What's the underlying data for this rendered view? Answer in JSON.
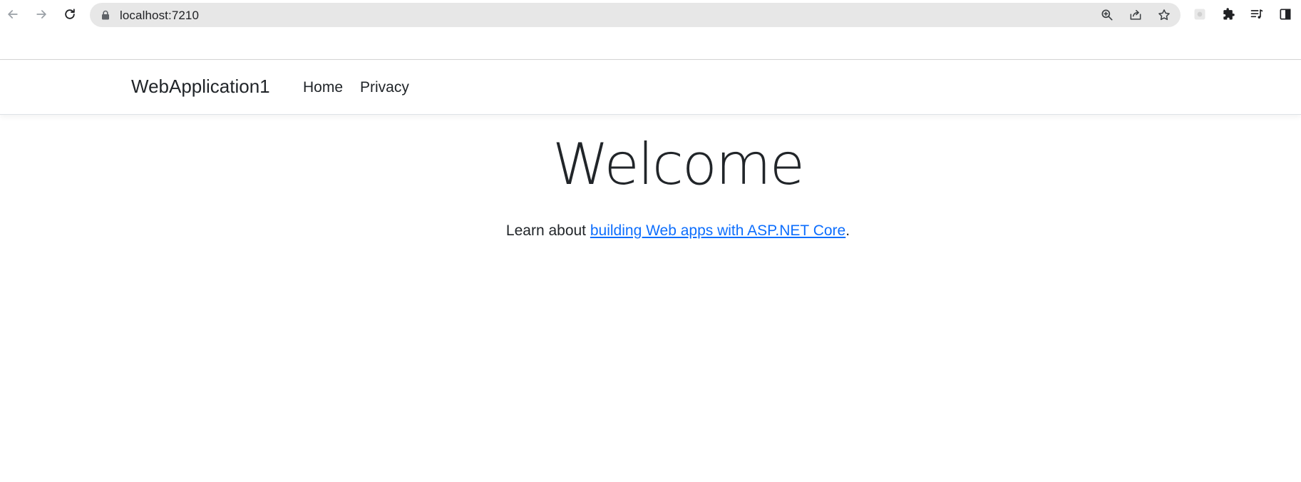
{
  "browser": {
    "url": "localhost:7210",
    "icons": {
      "back": "arrow-left-icon",
      "forward": "arrow-right-icon",
      "reload": "reload-icon",
      "lock": "lock-icon",
      "zoom": "zoom-icon",
      "share": "share-icon",
      "bookmark": "star-icon",
      "extension_blurred": "extension-icon",
      "extensions": "puzzle-icon",
      "media": "media-queue-icon",
      "sidepanel": "side-panel-icon"
    }
  },
  "navbar": {
    "brand": "WebApplication1",
    "links": [
      {
        "label": "Home"
      },
      {
        "label": "Privacy"
      }
    ]
  },
  "main": {
    "heading": "Welcome",
    "lead_prefix": "Learn about ",
    "lead_link": "building Web apps with ASP.NET Core",
    "lead_suffix": "."
  },
  "colors": {
    "text": "#212529",
    "link": "#0d6efd",
    "omnibox": "#e7e7e7"
  }
}
